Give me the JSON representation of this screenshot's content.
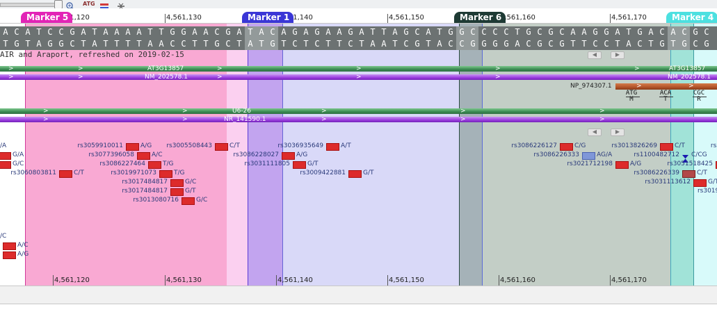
{
  "ruler": {
    "top_positions": [
      "4,561,120",
      "4,561,130",
      "4,561,140",
      "4,561,150",
      "4,561,160",
      "4,561,170"
    ],
    "bottom_positions": [
      "4,561,120",
      "4,561,130",
      "4,561,140",
      "4,561,150",
      "4,561,160",
      "4,561,170"
    ]
  },
  "markers": [
    {
      "label": "Marker 5",
      "color": "#e224b6"
    },
    {
      "label": "Marker 1",
      "color": "#3a36d6"
    },
    {
      "label": "Marker 6",
      "color": "#1e3a34"
    },
    {
      "label": "Marker 4",
      "color": "#4ce0e0"
    }
  ],
  "sequence": {
    "forward": "ACATCCGATAAAATTGGAACGATACAGAGAAGATTAGCATGGCCCCTGCGCAAGGATGACACGC",
    "reverse": "TGTAGGCTATTTTAACCTTGCTATGTCTCTTCTAATCGTACCGGGGACGCGTTCCTACTGTGCG"
  },
  "source_text": "AIR and Araport, refreshed on 2019-02-15",
  "tracks": {
    "gene1": "AT3G13857",
    "gene1_right": "AT3G13857",
    "rna1": "NM_202578.1",
    "rna1_right": "NM_202578.1",
    "protein": "NP_974307.1",
    "gene2": "U6-26",
    "rna2": "NR_141590.1"
  },
  "codons": [
    {
      "codon": "ATG",
      "aa": "M"
    },
    {
      "codon": "ACA",
      "aa": "T"
    },
    {
      "codon": "CGC",
      "aa": "R"
    }
  ],
  "snps": [
    {
      "id": "",
      "allele": "/A"
    },
    {
      "id": "",
      "allele": "G/A"
    },
    {
      "id": "",
      "allele": "G/C"
    },
    {
      "id": "rs3060803811",
      "allele": "C/T"
    },
    {
      "id": "",
      "allele": "/C"
    },
    {
      "id": "",
      "allele": "A/C"
    },
    {
      "id": "",
      "allele": "A/G"
    },
    {
      "id": "rs3059910011",
      "allele": "A/G"
    },
    {
      "id": "rs3077396058",
      "allele": "A/C"
    },
    {
      "id": "rs3086227464",
      "allele": "T/G"
    },
    {
      "id": "rs3019971073",
      "allele": "T/G"
    },
    {
      "id": "rs3017484817",
      "allele": "G/C"
    },
    {
      "id": "rs3017484817",
      "allele": "G/T"
    },
    {
      "id": "rs3013080716",
      "allele": "G/C"
    },
    {
      "id": "rs3005508443",
      "allele": "C/T"
    },
    {
      "id": "rs3086228027",
      "allele": "A/G"
    },
    {
      "id": "rs3031111805",
      "allele": "G/T"
    },
    {
      "id": "rs3036935649",
      "allele": "A/T"
    },
    {
      "id": "rs3009422881",
      "allele": "G/T"
    },
    {
      "id": "rs3086226127",
      "allele": "C/G"
    },
    {
      "id": "rs3086226333",
      "allele": "AG/A"
    },
    {
      "id": "rs3021712198",
      "allele": "A/G"
    },
    {
      "id": "rs3013826269",
      "allele": "C/T"
    },
    {
      "id": "rs1100482712",
      "allele": "C/CG"
    },
    {
      "id": "rs3051518425",
      "allele": ""
    },
    {
      "id": "rs3086226339",
      "allele": "C/T"
    },
    {
      "id": "rs3031113612",
      "allele": "G/T"
    },
    {
      "id": "rs30191",
      "allele": ""
    },
    {
      "id": "rs3",
      "allele": ""
    }
  ],
  "colors": {
    "marker5_region": "#f790c8",
    "marker1_region": "#b0b0ee",
    "marker6_region": "#a7b6a8",
    "marker4_region": "#a6f0f0",
    "sequence_bg": "#6c7272",
    "snp_red": "#dd2b2b",
    "snp_blue": "#7f97d8",
    "gene_green": "#3f9d5a",
    "rna_purple": "#9a3cde",
    "protein_brown": "#b2542a"
  },
  "icons": [
    "zoom-in-icon",
    "atg-icon",
    "align-icon",
    "collapse-icon",
    "slider-handle-icon",
    "scroll-left-icon",
    "scroll-right-icon"
  ]
}
